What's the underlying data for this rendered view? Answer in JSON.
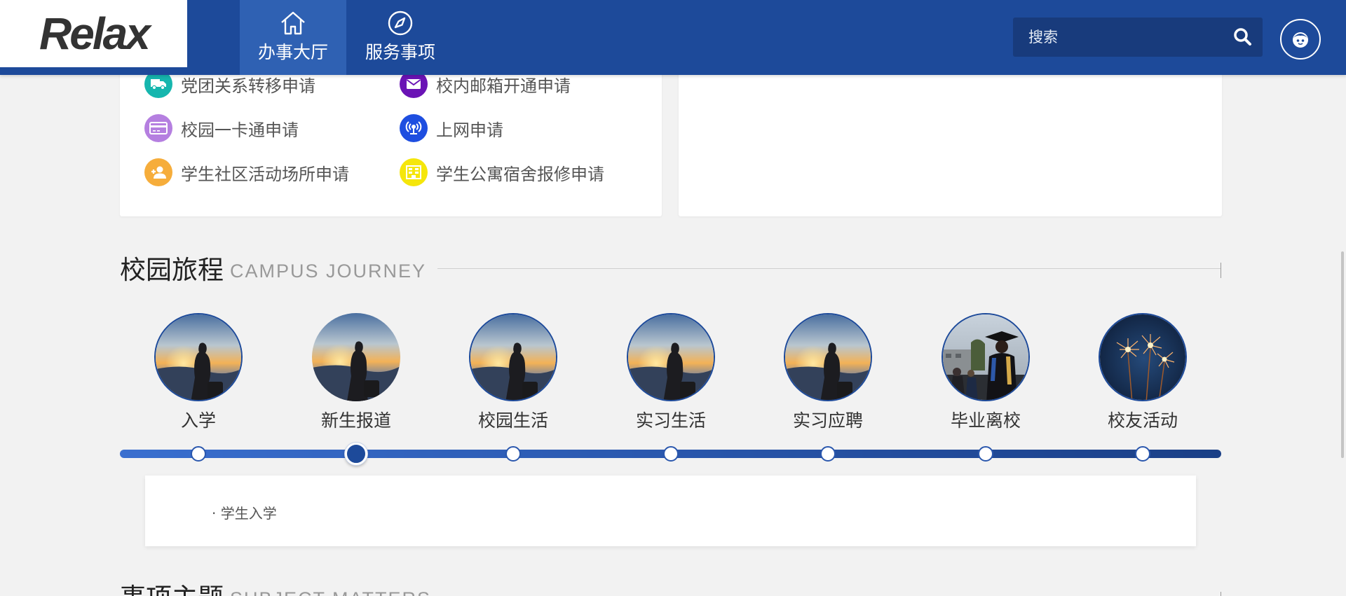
{
  "header": {
    "logo_text": "Relax",
    "nav": [
      {
        "label": "办事大厅",
        "icon": "home-icon",
        "active": true
      },
      {
        "label": "服务事项",
        "icon": "compass-icon",
        "active": false
      }
    ],
    "search": {
      "placeholder": "搜索"
    },
    "colors": {
      "primary": "#1d4a9a",
      "nav_active": "#2f61b3",
      "search_bg": "#183b7c"
    }
  },
  "services": [
    {
      "label": "党团关系转移申请",
      "icon": "truck-icon",
      "color": "#16b6ae"
    },
    {
      "label": "校内邮箱开通申请",
      "icon": "mail-icon",
      "color": "#6a13b5"
    },
    {
      "label": "校园一卡通申请",
      "icon": "card-icon",
      "color": "#b57fe0"
    },
    {
      "label": "上网申请",
      "icon": "wifi-icon",
      "color": "#1e4ee0"
    },
    {
      "label": "学生社区活动场所申请",
      "icon": "user-add-icon",
      "color": "#f6ad3b"
    },
    {
      "label": "学生公寓宿舍报修申请",
      "icon": "building-icon",
      "color": "#f5e60b"
    }
  ],
  "journey": {
    "title": "校园旅程",
    "subtitle": "CAMPUS JOURNEY",
    "stages": [
      {
        "label": "入学",
        "image": "traveler-photo"
      },
      {
        "label": "新生报道",
        "image": "traveler-photo"
      },
      {
        "label": "校园生活",
        "image": "traveler-photo"
      },
      {
        "label": "实习生活",
        "image": "traveler-photo"
      },
      {
        "label": "实习应聘",
        "image": "traveler-photo"
      },
      {
        "label": "毕业离校",
        "image": "graduation-photo"
      },
      {
        "label": "校友活动",
        "image": "sparklers-photo"
      }
    ],
    "active_index": 1,
    "detail": "· 学生入学"
  },
  "subject": {
    "title": "事项主题",
    "subtitle": "SUBJECT MATTERS"
  }
}
